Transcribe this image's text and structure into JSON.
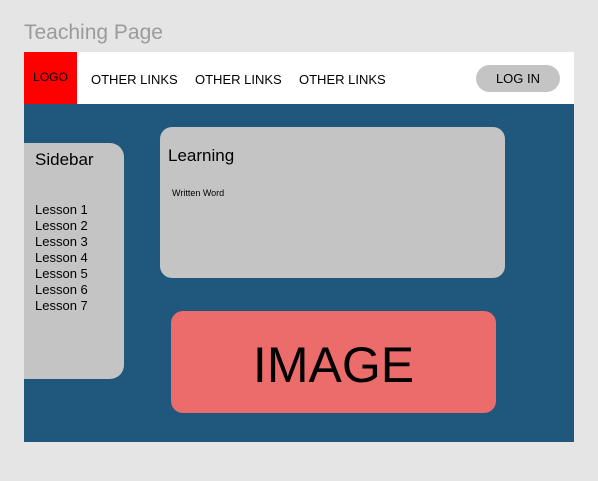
{
  "frame": {
    "title": "Teaching Page"
  },
  "navbar": {
    "logo": "LOGO",
    "links": [
      "OTHER LINKS",
      "OTHER LINKS",
      "OTHER LINKS"
    ],
    "login_label": "LOG IN"
  },
  "sidebar": {
    "title": "Sidebar",
    "items": [
      "Lesson 1",
      "Lesson 2",
      "Lesson 3",
      "Lesson 4",
      "Lesson 5",
      "Lesson 6",
      "Lesson 7"
    ]
  },
  "learning": {
    "title": "Learning",
    "text": "Written Word"
  },
  "image": {
    "label": "IMAGE"
  },
  "colors": {
    "page_background": "#e5e5e5",
    "frame_background": "#1f587c",
    "navbar_background": "#ffffff",
    "logo_background": "#ff0000",
    "panel_gray": "#c4c4c4",
    "image_background": "#ec6b6b",
    "frame_title_color": "#9b9b9b"
  }
}
